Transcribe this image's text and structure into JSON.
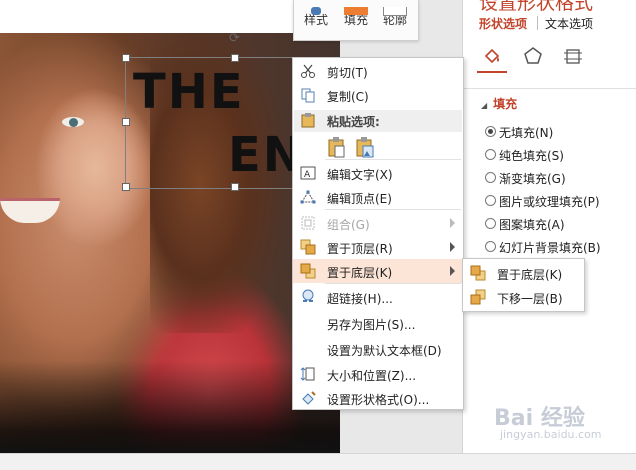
{
  "slide": {
    "wordart_line1": "THE",
    "wordart_line2": "EN"
  },
  "mini_toolbar": {
    "items": [
      {
        "label": "样式"
      },
      {
        "label": "填充"
      },
      {
        "label": "轮廓"
      }
    ]
  },
  "format_pane": {
    "title": "设置形状格式",
    "tabs": [
      {
        "label": "形状选项",
        "active": true
      },
      {
        "label": "文本选项",
        "active": false
      }
    ],
    "icons": [
      "fill-line-icon",
      "effects-pentagon-icon",
      "size-properties-icon"
    ],
    "section_label": "填充",
    "fill_options": [
      {
        "label": "无填充(N)",
        "selected": true
      },
      {
        "label": "纯色填充(S)",
        "selected": false
      },
      {
        "label": "渐变填充(G)",
        "selected": false
      },
      {
        "label": "图片或纹理填充(P)",
        "selected": false
      },
      {
        "label": "图案填充(A)",
        "selected": false
      },
      {
        "label": "幻灯片背景填充(B)",
        "selected": false
      }
    ]
  },
  "context_menu": {
    "cut": "剪切(T)",
    "copy": "复制(C)",
    "paste_options": "粘贴选项:",
    "edit_text": "编辑文字(X)",
    "edit_points": "编辑顶点(E)",
    "group": "组合(G)",
    "bring_to_front": "置于顶层(R)",
    "send_to_back": "置于底层(K)",
    "hyperlink": "超链接(H)...",
    "save_as_picture": "另存为图片(S)...",
    "set_default_textbox": "设置为默认文本框(D)",
    "size_position": "大小和位置(Z)...",
    "format_shape": "设置形状格式(O)..."
  },
  "submenu": {
    "send_to_back": "置于底层(K)",
    "send_backward": "下移一层(B)"
  },
  "watermark": {
    "text": "Bai 经验",
    "url": "jingyan.baidu.com"
  },
  "colors": {
    "accent": "#c3432b",
    "highlight": "#fce4d6",
    "menu_border": "#c6c6c6"
  }
}
